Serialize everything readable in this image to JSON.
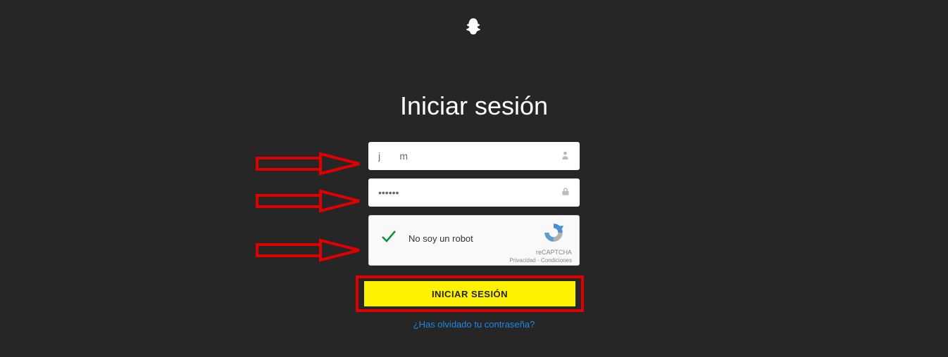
{
  "page": {
    "title": "Iniciar sesión"
  },
  "form": {
    "username_value": "j       m",
    "password_value": "······",
    "recaptcha_label": "No soy un robot",
    "recaptcha_brand": "reCAPTCHA",
    "recaptcha_privacy": "Privacidad",
    "recaptcha_terms": "Condiciones",
    "login_button": "INICIAR SESIÓN",
    "forgot_link": "¿Has olvidado tu contraseña?"
  }
}
